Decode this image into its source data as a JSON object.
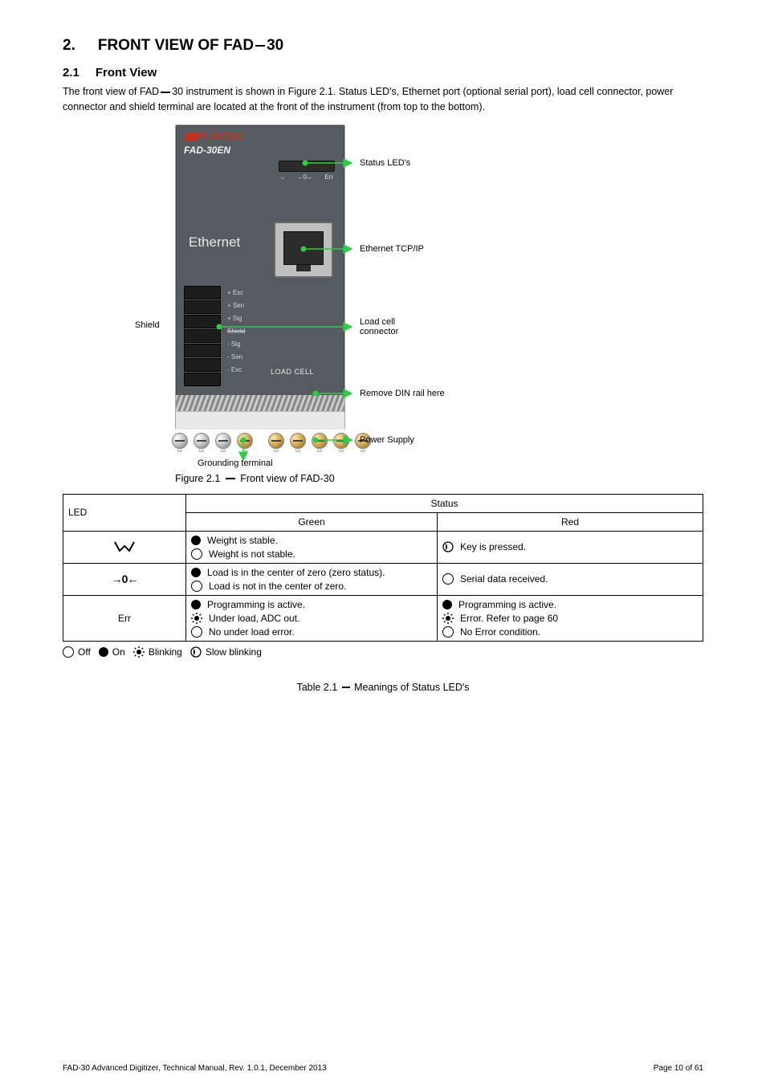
{
  "section": {
    "num": "2.",
    "title_a": "FRONT VIEW OF FAD",
    "title_b": "30"
  },
  "sub1": {
    "num": "2.1",
    "title": "Front View"
  },
  "para1_a": "The front view of FAD",
  "para1_b": "30 instrument is shown in Figure 2.1. Status LED's, Ethernet port (optional serial port), load cell connector, power connector and shield terminal are located at the front of the instrument (from top to the bottom).",
  "figure": {
    "brand": "FLINTEC",
    "model": "FAD-30EN",
    "led_row": {
      "l1": "⌵",
      "l2": "→0←",
      "l3": "Err"
    },
    "ethernet": "Ethernet",
    "tb": [
      "+ Exc",
      "+ Sen",
      "+ Sig",
      "",
      "- Sig",
      "- Sen",
      "- Exc"
    ],
    "load_cell": "LOAD  CELL",
    "screw_lbl_l": "Ln",
    "screw_lbl_r": "Ln",
    "anno": {
      "leds": "Status LED's",
      "eth": "Ethernet TCP/IP",
      "lc": "Load cell\nconnector",
      "power": "Power Supply",
      "shield_lbl": "Shield",
      "shield": "Grounding terminal",
      "din": "Remove DIN rail here"
    },
    "shield_on_face": "Shield"
  },
  "figcap_a": "Figure 2.1",
  "figcap_b": " Front view of FAD-30",
  "table": {
    "header": [
      "LED",
      "Status"
    ],
    "sub_cols": [
      "Green",
      "Red"
    ],
    "rows": [
      {
        "led_icon": "scale",
        "green": [
          {
            "sym": "on",
            "txt": "Weight is stable."
          },
          {
            "sym": "off",
            "txt": "Weight is not stable."
          }
        ],
        "red": [
          {
            "sym": "slow",
            "txt": "Key is pressed."
          }
        ]
      },
      {
        "led_icon": "zero",
        "green": [
          {
            "sym": "on",
            "txt": "Load is in the center of zero (zero status)."
          },
          {
            "sym": "off",
            "txt": "Load is not in the center of zero."
          }
        ],
        "red": [
          {
            "sym": "off",
            "txt": "Serial data received."
          }
        ]
      },
      {
        "led_icon_text": "Err",
        "green": [
          {
            "sym": "on",
            "txt": "Programming is active."
          },
          {
            "sym": "blink",
            "txt": "Under load, ADC out."
          },
          {
            "sym": "off",
            "txt": "No under load error."
          }
        ],
        "red": [
          {
            "sym": "on",
            "txt": "Programming is active."
          },
          {
            "sym": "blink",
            "txt": "Error. Refer to page 60"
          },
          {
            "sym": "off",
            "txt": "No Error condition."
          }
        ]
      }
    ]
  },
  "legend": {
    "off": "Off",
    "on": "On",
    "blink": "Blinking",
    "slow": "Slow blinking"
  },
  "table_cap": "Table 2.1 – Meanings of Status LED's",
  "footer": {
    "left": "FAD-30 Advanced Digitizer, Technical Manual, Rev. 1.0.1, December 2013",
    "right": "Page 10 of 61"
  }
}
